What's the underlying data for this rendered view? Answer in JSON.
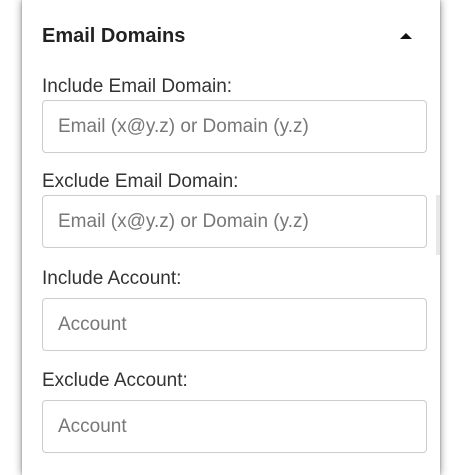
{
  "panel": {
    "title": "Email Domains",
    "toggle_icon": "caret-up-icon"
  },
  "fields": {
    "include_email_domain": {
      "label": "Include Email Domain:",
      "placeholder": "Email (x@y.z) or Domain (y.z)",
      "value": ""
    },
    "exclude_email_domain": {
      "label": "Exclude Email Domain:",
      "placeholder": "Email (x@y.z) or Domain (y.z)",
      "value": ""
    },
    "include_account": {
      "label": "Include Account:",
      "placeholder": "Account",
      "value": ""
    },
    "exclude_account": {
      "label": "Exclude Account:",
      "placeholder": "Account",
      "value": ""
    }
  },
  "colors": {
    "title": "#222222",
    "label": "#333333",
    "placeholder": "#777777",
    "input_border": "#cccccc"
  }
}
